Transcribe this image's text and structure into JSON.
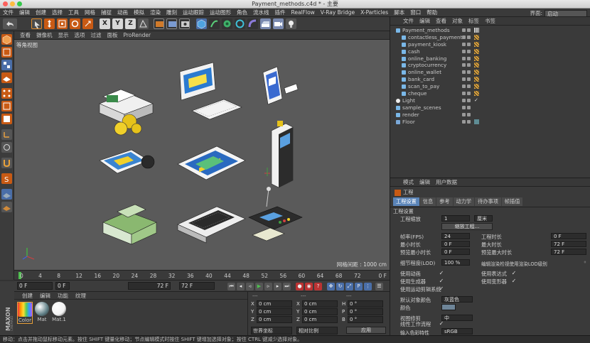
{
  "window": {
    "title": "Payment_methods.c4d * - 主要"
  },
  "menubar": {
    "items": [
      "文件",
      "编辑",
      "创建",
      "选择",
      "工具",
      "网格",
      "捕捉",
      "动画",
      "模拟",
      "渲染",
      "雕刻",
      "运动跟踪",
      "运动图形",
      "角色",
      "流水线",
      "插件",
      "RealFlow",
      "V-Ray Bridge",
      "X-Particles",
      "脚本",
      "窗口",
      "帮助"
    ],
    "layout_label": "界面:",
    "layout_value": "启动"
  },
  "viewport": {
    "menu": [
      "查看",
      "摄像机",
      "显示",
      "选项",
      "过滤",
      "面板",
      "ProRender"
    ],
    "label": "等角视图",
    "grid_readout": "网格间距 : 1000 cm"
  },
  "timeline": {
    "ticks": [
      "0",
      "4",
      "8",
      "12",
      "16",
      "20",
      "24",
      "28",
      "32",
      "36",
      "40",
      "44",
      "48",
      "52",
      "56",
      "60",
      "64",
      "68",
      "72"
    ],
    "end_frame": "0 F",
    "start_field": "0 F",
    "current_field": "0 F",
    "end_field_a": "72 F",
    "end_field_b": "72 F"
  },
  "materials": {
    "menu": [
      "创建",
      "编辑",
      "功能",
      "纹理"
    ],
    "items": [
      {
        "label": "Color",
        "color": "#e3b02a"
      },
      {
        "label": "Mat",
        "color": "#607f86"
      },
      {
        "label": "Mat.1",
        "color": "#f2f2f2"
      }
    ]
  },
  "coordinates": {
    "header_left": "---",
    "header_mid": "---",
    "header_right": "---",
    "rows": [
      {
        "axis": "X",
        "pos": "0 cm",
        "axis2": "X",
        "size": "0 cm",
        "axis3": "H",
        "rot": "0 °"
      },
      {
        "axis": "Y",
        "pos": "0 cm",
        "axis2": "Y",
        "size": "0 cm",
        "axis3": "P",
        "rot": "0 °"
      },
      {
        "axis": "Z",
        "pos": "0 cm",
        "axis2": "Z",
        "size": "0 cm",
        "axis3": "B",
        "rot": "0 °"
      }
    ],
    "mode_world": "世界坐标",
    "mode_scale": "相对比例",
    "apply": "应用"
  },
  "objects": {
    "menu": [
      "文件",
      "编辑",
      "查看",
      "对象",
      "标签",
      "书签"
    ],
    "tree": [
      {
        "name": "Payment_methods",
        "indent": 0,
        "tag": "grid"
      },
      {
        "name": "contactless_payment",
        "indent": 1,
        "tag": "x"
      },
      {
        "name": "payment_kiosk",
        "indent": 1,
        "tag": "x"
      },
      {
        "name": "cash",
        "indent": 1,
        "tag": "x"
      },
      {
        "name": "online_banking",
        "indent": 1,
        "tag": "x"
      },
      {
        "name": "cryptocurrency",
        "indent": 1,
        "tag": "x"
      },
      {
        "name": "online_wallet",
        "indent": 1,
        "tag": "x"
      },
      {
        "name": "bank_card",
        "indent": 1,
        "tag": "x"
      },
      {
        "name": "scan_to_pay",
        "indent": 1,
        "tag": "x"
      },
      {
        "name": "cheque",
        "indent": 1,
        "tag": "x"
      },
      {
        "name": "Light",
        "indent": 0,
        "tag": "check"
      },
      {
        "name": "sample_scenes",
        "indent": 0,
        "tag": "none"
      },
      {
        "name": "render",
        "indent": 0,
        "tag": "none"
      },
      {
        "name": "Floor",
        "indent": 0,
        "tag": "teal"
      }
    ]
  },
  "attributes": {
    "menu": [
      "模式",
      "编辑",
      "用户数据"
    ],
    "object_title": "工程",
    "tabs": [
      "工程设置",
      "信息",
      "参考",
      "动力学",
      "待办事项",
      "帧插值"
    ],
    "section": "工程设置",
    "scale_label": "工程缩放",
    "scale_value": "1",
    "scale_unit": "厘米",
    "scale_button": "缩放工程...",
    "fps_label": "帧率(FPS)",
    "fps_value": "24",
    "duration_label": "工程时长",
    "duration_value": "0 F",
    "min_time_label": "最小时长",
    "min_time_value": "0 F",
    "max_time_label": "最大时长",
    "max_time_value": "72 F",
    "preview_min_label": "预览最小时长",
    "preview_min_value": "0 F",
    "preview_max_label": "预览最大时长",
    "preview_max_value": "72 F",
    "lod_label": "细节程度(LOD)",
    "lod_value": "100 %",
    "lod_option": "编辑渲染检视使用渲染LOD级别",
    "use_anim": "使用动画",
    "use_expr": "使用表达式",
    "use_gen": "使用生成器",
    "use_deform": "使用变形器",
    "use_motion": "使用运动剪辑系统",
    "default_color_label": "默认对象颜色",
    "default_color_value": "灰蓝色",
    "color_label": "颜色",
    "view_clip_label": "视图修剪",
    "view_clip_value": "中",
    "linear_label": "线性工作流程",
    "input_profile_label": "输入色彩特性",
    "input_profile_value": "sRGB"
  },
  "status": {
    "text": "移动：点击并拖动鼠标移动元素。按住 SHIFT 键量化移动；节点编辑模式时按住 SHIFT 键增加选择对象；按住 CTRL 键减少选择对象。"
  }
}
